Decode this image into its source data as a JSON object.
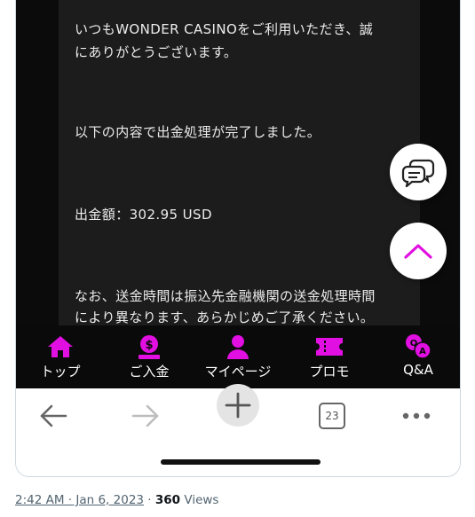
{
  "email": {
    "line1": "いつもWONDER CASINOをご利用いただき、誠",
    "line2": "にありがとうございます。",
    "line3": "以下の内容で出金処理が完了しました。",
    "line4": "出金額：302.95 USD",
    "line5": "なお、送金時間は振込先金融機関の送金処理時間",
    "line6": "により異なります、あらかじめご了承ください。"
  },
  "app_nav": {
    "accent": "#e10fe1",
    "items": [
      {
        "label": "トップ",
        "icon": "home-icon"
      },
      {
        "label": "ご入金",
        "icon": "deposit-icon"
      },
      {
        "label": "マイページ",
        "icon": "user-icon"
      },
      {
        "label": "プロモ",
        "icon": "ticket-icon"
      },
      {
        "label": "Q&A",
        "icon": "qa-icon"
      }
    ]
  },
  "browser_toolbar": {
    "tab_count": "23",
    "icons": [
      "back-arrow-icon",
      "forward-arrow-icon",
      "new-tab-plus-icon",
      "tab-switcher-icon",
      "more-menu-icon"
    ]
  },
  "floating": {
    "chat_icon": "chat-bubbles-icon",
    "up_icon": "chevron-up-icon"
  },
  "tweet_meta": {
    "time": "2:42 AM · Jan 6, 2023",
    "sep": "·",
    "views_count": "360",
    "views_label": "Views"
  }
}
